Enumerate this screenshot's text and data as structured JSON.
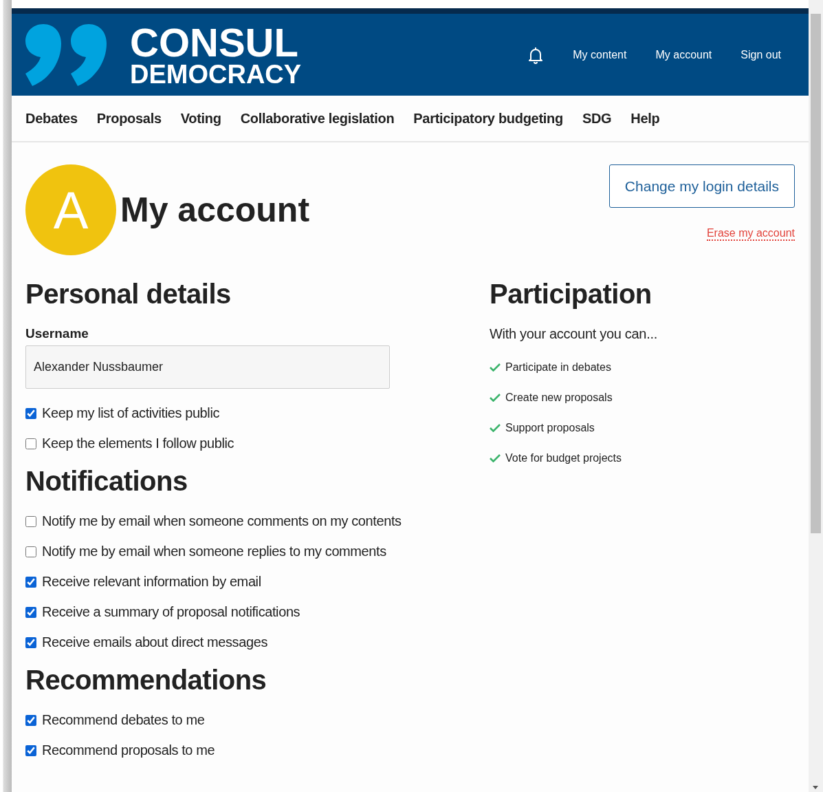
{
  "header": {
    "logo": {
      "line_1": "CONSUL",
      "line_2": "DEMOCRACY"
    },
    "links": [
      "My content",
      "My account",
      "Sign out"
    ]
  },
  "nav": [
    "Debates",
    "Proposals",
    "Voting",
    "Collaborative legislation",
    "Participatory budgeting",
    "SDG",
    "Help"
  ],
  "account": {
    "avatar_letter": "A",
    "title": "My account",
    "change_button": "Change my login details",
    "erase_link": "Erase my account"
  },
  "personal": {
    "heading": "Personal details",
    "username_label": "Username",
    "username": "Alexander Nussbaumer",
    "options": [
      {
        "label": "Keep my list of activities public",
        "checked": true
      },
      {
        "label": "Keep the elements I follow public",
        "checked": false
      }
    ]
  },
  "notifications": {
    "heading": "Notifications",
    "options": [
      {
        "label": "Notify me by email when someone comments on my contents",
        "checked": false
      },
      {
        "label": "Notify me by email when someone replies to my comments",
        "checked": false
      },
      {
        "label": "Receive relevant information by email",
        "checked": true
      },
      {
        "label": "Receive a summary of proposal notifications",
        "checked": true
      },
      {
        "label": "Receive emails about direct messages",
        "checked": true
      }
    ]
  },
  "recommendations": {
    "heading": "Recommendations",
    "options": [
      {
        "label": "Recommend debates to me",
        "checked": true
      },
      {
        "label": "Recommend proposals to me",
        "checked": true
      }
    ]
  },
  "participation": {
    "heading": "Participation",
    "intro": "With your account you can...",
    "items": [
      "Participate in debates",
      "Create new proposals",
      "Support proposals",
      "Vote for budget projects"
    ]
  }
}
